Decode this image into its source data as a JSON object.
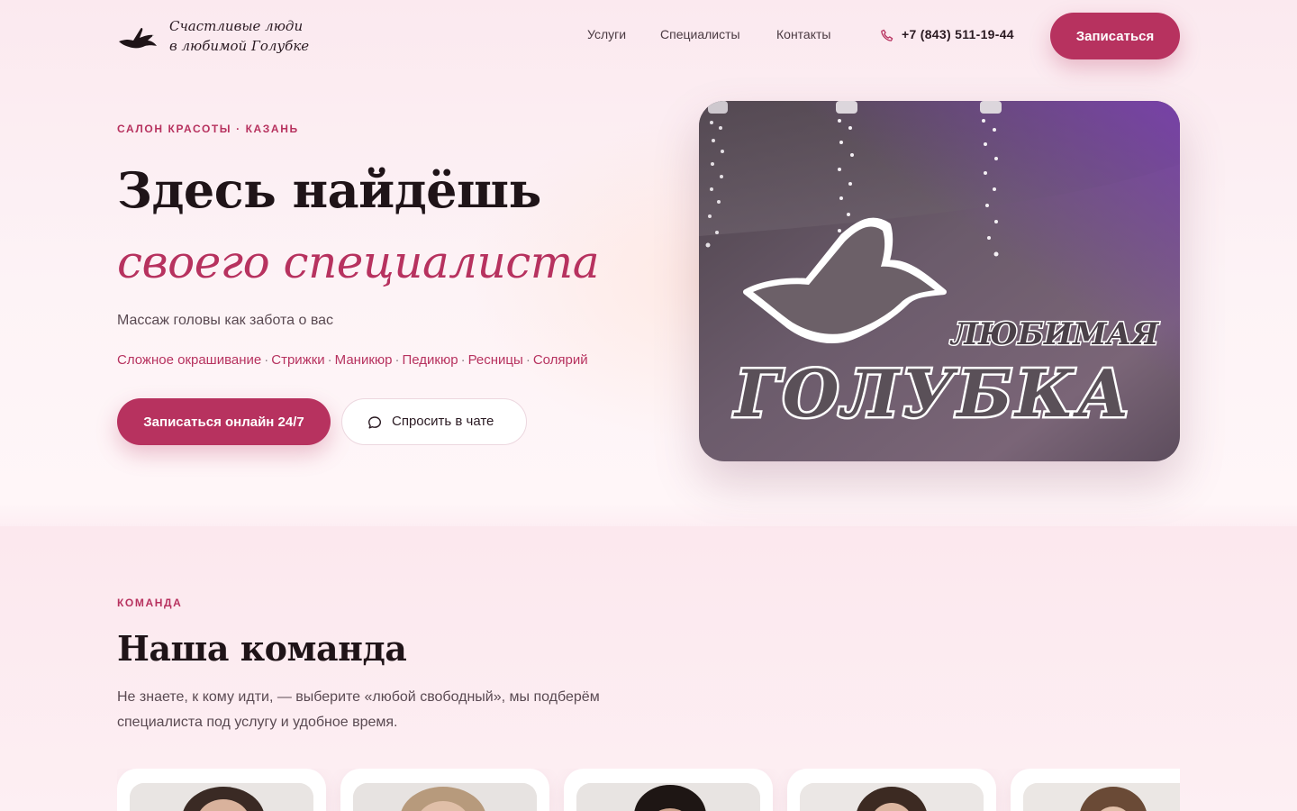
{
  "header": {
    "logo_line1": "Счастливые люди",
    "logo_line2": "в любимой Голубке",
    "nav": [
      "Услуги",
      "Специалисты",
      "Контакты"
    ],
    "phone": "+7 (843) 511-19-44",
    "cta": "Записаться"
  },
  "hero": {
    "eyebrow": "САЛОН КРАСОТЫ · КАЗАНЬ",
    "title_line1": "Здесь найдёшь",
    "title_line2": "своего специалиста",
    "subtitle": "Массаж головы как забота о вас",
    "services": [
      "Сложное окрашивание",
      "Стрижки",
      "Маникюр",
      "Педикюр",
      "Ресницы",
      "Солярий"
    ],
    "cta_primary": "Записаться онлайн 24/7",
    "cta_chat": "Спросить в чате",
    "photo": {
      "sign_line1": "ЛЮБИМАЯ",
      "sign_line2": "ГОЛУБКА"
    }
  },
  "team": {
    "eyebrow": "КОМАНДА",
    "title": "Наша команда",
    "description": "Не знаете, к кому идти, — выберите «любой свободный», мы подберём специалиста под услугу и удобное время.",
    "card_count": 5
  },
  "colors": {
    "accent": "#b7325f",
    "text_dark": "#1f1418",
    "text_muted": "#5a4a52",
    "background": "#fdf1f4"
  },
  "icons": {
    "logo": "dove-icon",
    "phone": "phone-icon",
    "chat": "chat-bubble-icon"
  }
}
